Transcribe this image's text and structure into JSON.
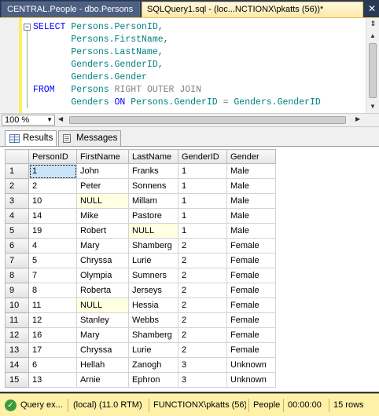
{
  "tabs": [
    {
      "label": "CENTRAL.People - dbo.Persons"
    },
    {
      "label": "SQLQuery1.sql - (loc...NCTIONX\\pkatts (56))*"
    }
  ],
  "code": {
    "l1": {
      "kw": "SELECT",
      "rest": "Persons.PersonID,"
    },
    "l2": "Persons.FirstName,",
    "l3": "Persons.LastName,",
    "l4": "Genders.GenderID,",
    "l5": "Genders.Gender",
    "l6": {
      "kw": "FROM",
      "table": "Persons",
      "join": "RIGHT OUTER JOIN"
    },
    "l7": {
      "table": "Genders",
      "on": "ON",
      "left": "Persons.GenderID",
      "eq": "=",
      "right": "Genders.GenderID"
    }
  },
  "zoom": "100 %",
  "result_tabs": {
    "results": "Results",
    "messages": "Messages"
  },
  "grid": {
    "columns": [
      "PersonID",
      "FirstName",
      "LastName",
      "GenderID",
      "Gender"
    ],
    "rows": [
      [
        "1",
        "1",
        "John",
        "Franks",
        "1",
        "Male"
      ],
      [
        "2",
        "2",
        "Peter",
        "Sonnens",
        "1",
        "Male"
      ],
      [
        "3",
        "10",
        "NULL",
        "Millam",
        "1",
        "Male"
      ],
      [
        "4",
        "14",
        "Mike",
        "Pastore",
        "1",
        "Male"
      ],
      [
        "5",
        "19",
        "Robert",
        "NULL",
        "1",
        "Male"
      ],
      [
        "6",
        "4",
        "Mary",
        "Shamberg",
        "2",
        "Female"
      ],
      [
        "7",
        "5",
        "Chryssa",
        "Lurie",
        "2",
        "Female"
      ],
      [
        "8",
        "7",
        "Olympia",
        "Sumners",
        "2",
        "Female"
      ],
      [
        "9",
        "8",
        "Roberta",
        "Jerseys",
        "2",
        "Female"
      ],
      [
        "10",
        "11",
        "NULL",
        "Hessia",
        "2",
        "Female"
      ],
      [
        "11",
        "12",
        "Stanley",
        "Webbs",
        "2",
        "Female"
      ],
      [
        "12",
        "16",
        "Mary",
        "Shamberg",
        "2",
        "Female"
      ],
      [
        "13",
        "17",
        "Chryssa",
        "Lurie",
        "2",
        "Female"
      ],
      [
        "14",
        "6",
        "Hellah",
        "Zanogh",
        "3",
        "Unknown"
      ],
      [
        "15",
        "13",
        "Arnie",
        "Ephron",
        "3",
        "Unknown"
      ]
    ]
  },
  "status": {
    "query": "Query ex...",
    "server": "(local) (11.0 RTM)",
    "user": "FUNCTIONX\\pkatts (56)",
    "db": "People",
    "time": "00:00:00",
    "rows": "15 rows"
  },
  "colors": {
    "tab_active": "#ffe8a6",
    "background": "#293955",
    "status": "#fff2a8",
    "null_cell": "#ffffe1"
  }
}
